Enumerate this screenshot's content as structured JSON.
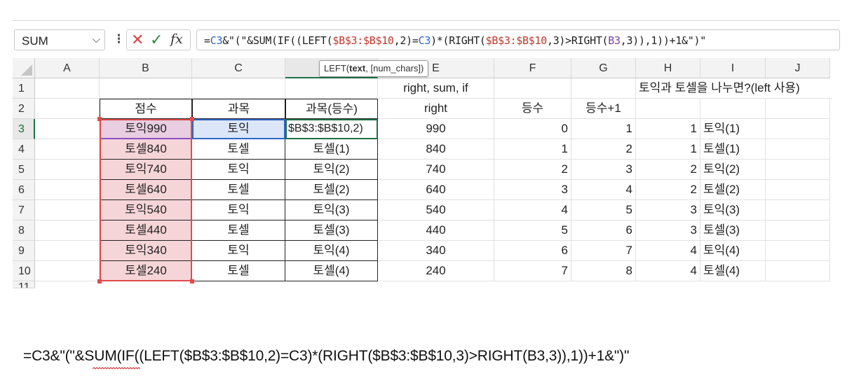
{
  "formula_bar": {
    "name_box": "SUM",
    "formula": "=C3&\"(\"&SUM(IF((LEFT($B$3:$B$10,2)=C3)*(RIGHT($B$3:$B$10,3)>RIGHT(B3,3)),1))+1&\")\"",
    "formula_parts": [
      "=",
      "C3",
      "&\"(\"&SUM(IF((LEFT(",
      "$B$3:$B$10",
      ",2)=",
      "C3",
      ")*(RIGHT(",
      "$B$3:$B$10",
      ",3)>RIGHT(",
      "B3",
      ",3)),1))+1&\")\""
    ]
  },
  "tooltip": {
    "fn": "LEFT(",
    "bold": "text",
    "rest": ", [num_chars])"
  },
  "columns": [
    "A",
    "B",
    "C",
    "D",
    "E",
    "F",
    "G",
    "H",
    "I",
    "J"
  ],
  "rows": [
    "1",
    "2",
    "3",
    "4",
    "5",
    "6",
    "7",
    "8",
    "9",
    "10",
    "11"
  ],
  "header_row1": {
    "e": "right, sum, if",
    "h": "토익과 토셀을 나누면?(left 사용)"
  },
  "header_row2": {
    "b": "점수",
    "c": "과목",
    "d": "과목(등수)",
    "e": "right",
    "f": "등수",
    "g": "등수+1"
  },
  "edit_cell_text": "$B$3:$B$10,2)",
  "table": [
    {
      "b": "토익990",
      "c": "토익",
      "d": "",
      "e": "990",
      "f": "0",
      "g": "1",
      "h": "1",
      "i": "토익(1)"
    },
    {
      "b": "토셀840",
      "c": "토셀",
      "d": "토셀(1)",
      "e": "840",
      "f": "1",
      "g": "2",
      "h": "1",
      "i": "토셀(1)"
    },
    {
      "b": "토익740",
      "c": "토익",
      "d": "토익(2)",
      "e": "740",
      "f": "2",
      "g": "3",
      "h": "2",
      "i": "토익(2)"
    },
    {
      "b": "토셀640",
      "c": "토셀",
      "d": "토셀(2)",
      "e": "640",
      "f": "3",
      "g": "4",
      "h": "2",
      "i": "토셀(2)"
    },
    {
      "b": "토익540",
      "c": "토익",
      "d": "토익(3)",
      "e": "540",
      "f": "4",
      "g": "5",
      "h": "3",
      "i": "토익(3)"
    },
    {
      "b": "토셀440",
      "c": "토셀",
      "d": "토셀(3)",
      "e": "440",
      "f": "5",
      "g": "6",
      "h": "3",
      "i": "토셀(3)"
    },
    {
      "b": "토익340",
      "c": "토익",
      "d": "토익(4)",
      "e": "340",
      "f": "6",
      "g": "7",
      "h": "4",
      "i": "토익(4)"
    },
    {
      "b": "토셀240",
      "c": "토셀",
      "d": "토셀(4)",
      "e": "240",
      "f": "7",
      "g": "8",
      "h": "4",
      "i": "토셀(4)"
    }
  ],
  "bottom_caption": "=C3&\"(\"&SUM(IF((LEFT($B$3:$B$10,2)=C3)*(RIGHT($B$3:$B$10,3)>RIGHT(B3,3)),1))+1&\")\"",
  "colors": {
    "range_red": "#e04b4b",
    "range_fill": "#f6d5d8",
    "ref_blue": "#2f67c8",
    "ref_blue_fill": "#dbe6f8",
    "ref_purple": "#8a4fc7",
    "active_green": "#1e7145"
  }
}
